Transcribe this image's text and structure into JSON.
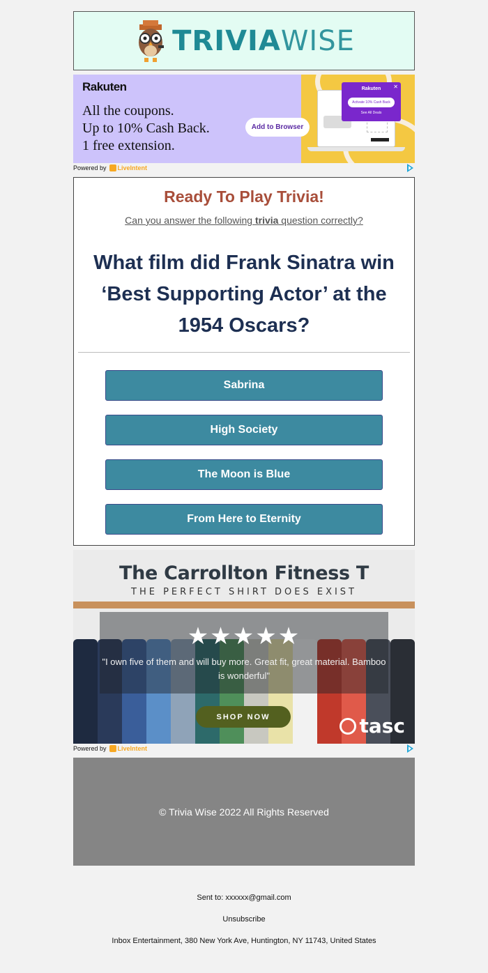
{
  "header": {
    "logo_trivia": "TRIVIA",
    "logo_wise": "WISE"
  },
  "ad_top": {
    "brand": "Rakuten",
    "lines": [
      "All the coupons.",
      "Up to 10% Cash Back.",
      "1 free extension."
    ],
    "cta": "Add to Browser",
    "popup_brand": "Rakuten",
    "popup_button": "Activate 10% Cash Back",
    "popup_link": "See All Deals",
    "powered_by": "Powered by",
    "powered_brand": "LiveIntent"
  },
  "trivia": {
    "title": "Ready To Play Trivia!",
    "subtitle_pre": "Can you answer the following ",
    "subtitle_bold": "trivia",
    "subtitle_post": " question correctly?",
    "question": "What film did Frank Sinatra win ‘Best Supporting Actor’ at the 1954 Oscars?",
    "answers": [
      "Sabrina",
      "High Society",
      "The Moon is Blue",
      "From Here to Eternity"
    ]
  },
  "ad_bottom": {
    "title": "The Carrollton Fitness T",
    "tagline": "THE PERFECT SHIRT DOES EXIST",
    "stars": "★★★★★",
    "rating": "5 of 5",
    "quote": "\"I own five of them and will buy more. Great fit, great material. Bamboo is wonderful\"",
    "cta": "SHOP NOW",
    "brand": "tasc",
    "powered_by": "Powered by",
    "powered_brand": "LiveIntent"
  },
  "footer": {
    "copyright": "© Trivia Wise 2022 All Rights Reserved",
    "sent_to": "Sent to: xxxxxx@gmail.com",
    "unsubscribe": "Unsubscribe",
    "address": "Inbox Entertainment, 380 New York Ave, Huntington, NY 11743, United States"
  },
  "colors": {
    "accent": "#3d8aa0",
    "title": "#a84e3a",
    "question": "#1d2f52"
  }
}
